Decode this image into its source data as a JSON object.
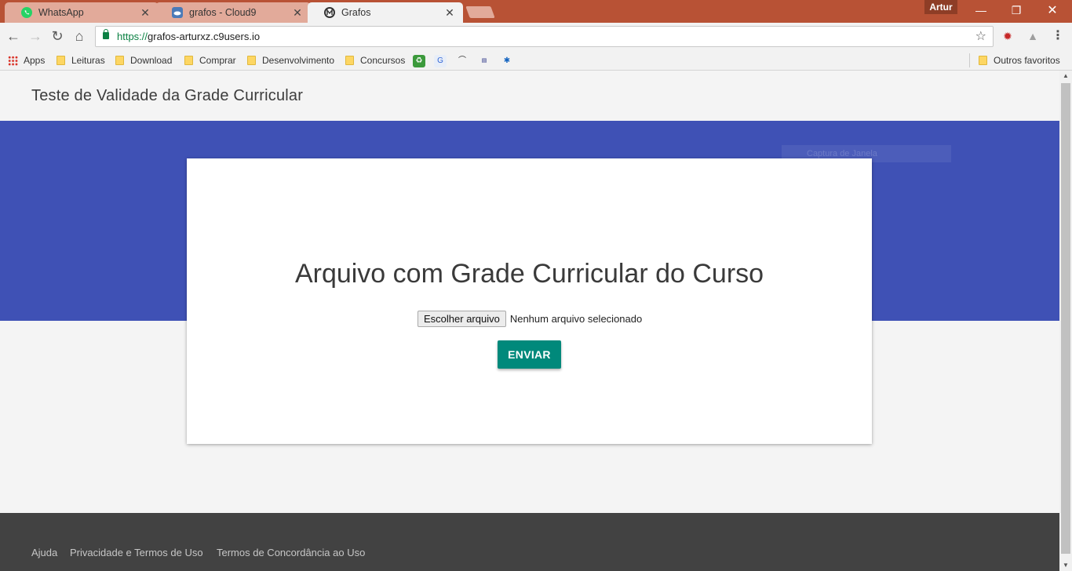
{
  "browser": {
    "tabs": [
      {
        "title": "WhatsApp",
        "icon": "whatsapp-icon",
        "color": "#25d366"
      },
      {
        "title": "grafos - Cloud9",
        "icon": "cloud9-icon",
        "color": "#4a7ab8"
      },
      {
        "title": "Grafos",
        "icon": "grafos-icon",
        "color": "#333333"
      }
    ],
    "profile": "Artur",
    "url_scheme": "https://",
    "url_host": "grafos-arturxz.c9users.io",
    "bookmarks": {
      "apps": "Apps",
      "folders": [
        "Leituras",
        "Download",
        "Comprar",
        "Desenvolvimento",
        "Concursos"
      ],
      "other": "Outros favoritos"
    }
  },
  "page": {
    "header_title": "Teste de Validade da Grade Curricular",
    "ghost_label": "Captura de Janela",
    "card_title": "Arquivo com Grade Curricular do Curso",
    "file_button": "Escolher arquivo",
    "file_status": "Nenhum arquivo selecionado",
    "submit_label": "ENVIAR",
    "footer_links": [
      "Ajuda",
      "Privacidade e Termos de Uso",
      "Termos de Concordância ao Uso"
    ]
  },
  "colors": {
    "titlebar": "#b85235",
    "hero": "#3f51b5",
    "submit": "#00897b",
    "footer": "#424242"
  }
}
